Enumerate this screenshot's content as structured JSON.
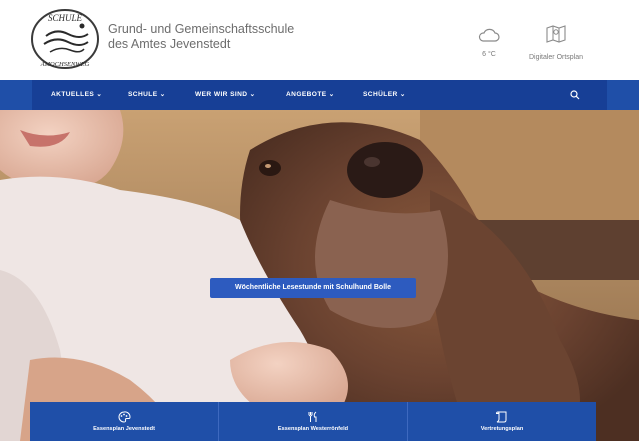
{
  "header": {
    "logo": {
      "text_top": "SCHULE",
      "text_bottom": "AMOCHSENWEG"
    },
    "school_name_line1": "Grund- und Gemeinschaftsschule",
    "school_name_line2": "des Amtes Jevenstedt",
    "weather": {
      "icon": "cloud-icon",
      "temperature": "6 °C"
    },
    "map": {
      "icon": "map-icon",
      "label": "Digitaler Ortsplan"
    }
  },
  "nav": {
    "items": [
      {
        "label": "AKTUELLES ⌄"
      },
      {
        "label": "SCHULE ⌄"
      },
      {
        "label": "WER WIR SIND ⌄"
      },
      {
        "label": "ANGEBOTE ⌄"
      },
      {
        "label": "SCHÜLER ⌄"
      }
    ],
    "search_icon": "search-icon"
  },
  "hero": {
    "caption": "Wöchentliche Lesestunde mit Schulhund Bolle"
  },
  "quick_links": [
    {
      "icon": "palette-icon",
      "label": "Essensplan Jevenstedt"
    },
    {
      "icon": "cutlery-icon",
      "label": "Essensplan Westerrönfeld"
    },
    {
      "icon": "scroll-icon",
      "label": "Vertretungsplan"
    }
  ],
  "colors": {
    "nav_blue": "#1f4fa8",
    "nav_inner": "#173f96",
    "caption_blue": "#2d5bbf",
    "text_grey": "#6d6d6d"
  }
}
